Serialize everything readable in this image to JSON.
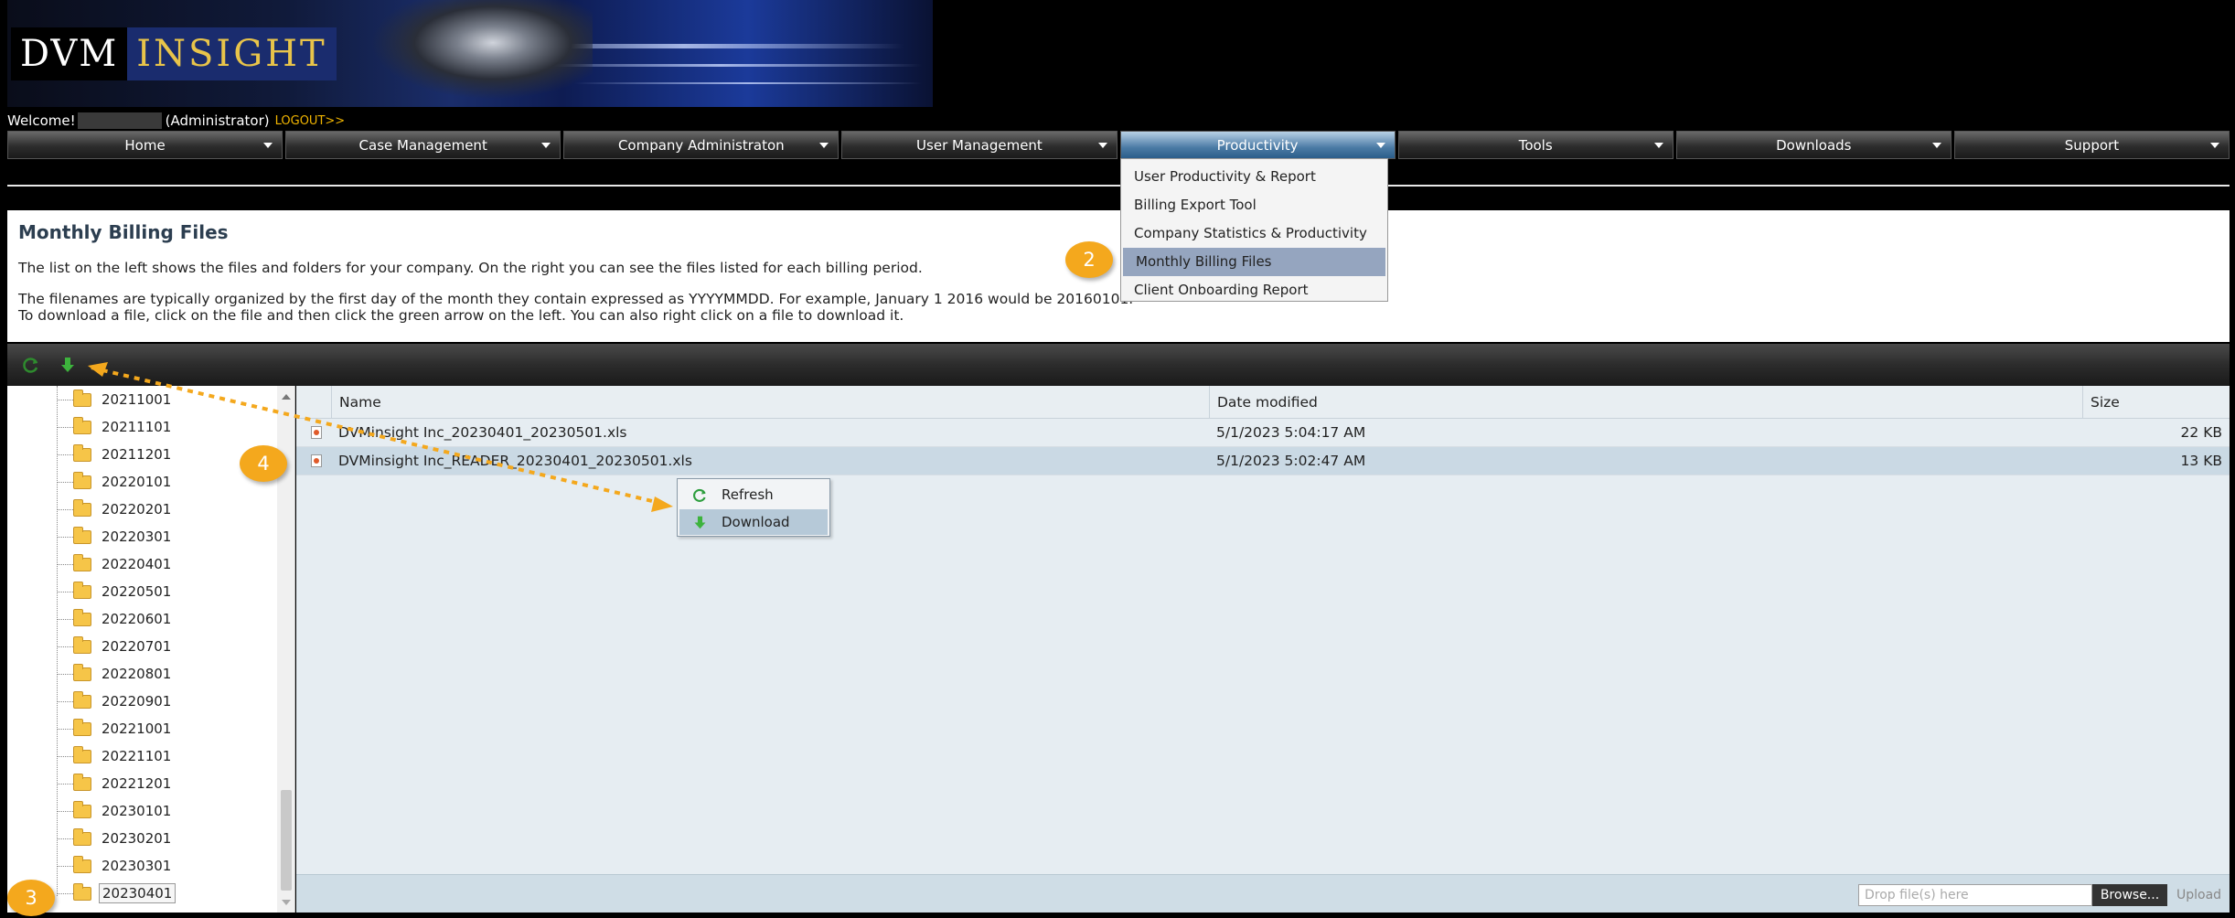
{
  "header": {
    "logo_left": "DVM",
    "logo_right": "INSIGHT",
    "welcome": "Welcome!",
    "role": "(Administrator)",
    "logout": "LOGOUT>>"
  },
  "menu": [
    {
      "label": "Home"
    },
    {
      "label": "Case Management"
    },
    {
      "label": "Company Administraton"
    },
    {
      "label": "User Management"
    },
    {
      "label": "Productivity"
    },
    {
      "label": "Tools"
    },
    {
      "label": "Downloads"
    },
    {
      "label": "Support"
    }
  ],
  "dropdown": [
    {
      "label": "User Productivity & Report"
    },
    {
      "label": "Billing Export Tool"
    },
    {
      "label": "Company Statistics & Productivity"
    },
    {
      "label": "Monthly Billing Files"
    },
    {
      "label": "Client Onboarding Report"
    }
  ],
  "panel": {
    "title": "Monthly Billing Files",
    "p1": "The list on the left shows the files and folders for your company.  On the right you can see the files listed for each billing period.",
    "p2a": "The filenames are typically organized by the first day of the month they contain expressed as YYYYMMDD. For example, January 1 2016 would be 20160101.",
    "p2b": "To download a file, click on the file and then click the green arrow on the left. You can also right click on a file to download it."
  },
  "tree": {
    "folders": [
      "20211001",
      "20211101",
      "20211201",
      "20220101",
      "20220201",
      "20220301",
      "20220401",
      "20220501",
      "20220601",
      "20220701",
      "20220801",
      "20220901",
      "20221001",
      "20221101",
      "20221201",
      "20230101",
      "20230201",
      "20230301",
      "20230401"
    ]
  },
  "files": {
    "columns": {
      "name": "Name",
      "date": "Date modified",
      "size": "Size"
    },
    "rows": [
      {
        "name": "DVMinsight Inc_20230401_20230501.xls",
        "date": "5/1/2023 5:04:17 AM",
        "size": "22 KB"
      },
      {
        "name": "DVMinsight Inc_READER_20230401_20230501.xls",
        "date": "5/1/2023 5:02:47 AM",
        "size": "13 KB"
      }
    ]
  },
  "context_menu": {
    "refresh": "Refresh",
    "download": "Download"
  },
  "upload": {
    "placeholder": "Drop file(s) here",
    "browse": "Browse...",
    "upload": "Upload"
  },
  "annotations": {
    "step2": "2",
    "step3": "3",
    "step4": "4"
  },
  "colors": {
    "annotation": "#f4a81d",
    "active_menu": "#4b7ba5",
    "highlight": "#95a5bf",
    "download_green": "#3db33d"
  }
}
